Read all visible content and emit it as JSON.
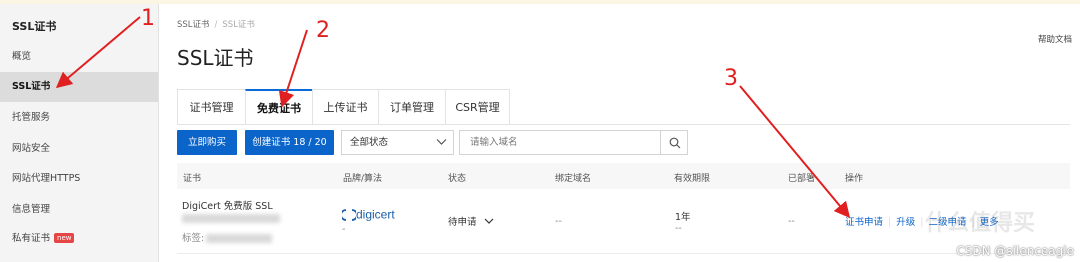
{
  "sidebar": {
    "title": "SSL证书",
    "items": [
      {
        "label": "概览"
      },
      {
        "label": "SSL证书"
      },
      {
        "label": "托管服务"
      },
      {
        "label": "网站安全"
      },
      {
        "label": "网站代理HTTPS"
      },
      {
        "label": "信息管理"
      },
      {
        "label": "私有证书",
        "badge": "new"
      }
    ]
  },
  "breadcrumb": {
    "root": "SSL证书",
    "sep": "/",
    "current": "SSL证书"
  },
  "page": {
    "title": "SSL证书",
    "help": "帮助文档"
  },
  "tabs": [
    "证书管理",
    "免费证书",
    "上传证书",
    "订单管理",
    "CSR管理"
  ],
  "toolbar": {
    "buy_label": "立即购买",
    "create_label": "创建证书 18 / 20",
    "status_value": "全部状态",
    "search_placeholder": "请输入域名"
  },
  "table": {
    "headers": [
      "证书",
      "品牌/算法",
      "状态",
      "绑定域名",
      "有效期限",
      "已部署",
      "操作"
    ],
    "row": {
      "cert_name": "DigiCert 免费版 SSL",
      "cert_tag_prefix": "标签:",
      "brand": "digicert",
      "brand_sub": "-",
      "status": "待申请",
      "domain": "--",
      "validity": "1年",
      "validity_sub": "--",
      "deployed": "--",
      "ops": [
        "证书申请",
        "升级",
        "二级申请",
        "更多"
      ]
    }
  },
  "annotations": {
    "n1": "1",
    "n2": "2",
    "n3": "3"
  },
  "watermark": {
    "text": "CSDN @silenceagle",
    "bg_text": "什么值得买"
  },
  "colors": {
    "accent": "#0b64c9",
    "annotation": "#e02020",
    "badge": "#e54545"
  }
}
